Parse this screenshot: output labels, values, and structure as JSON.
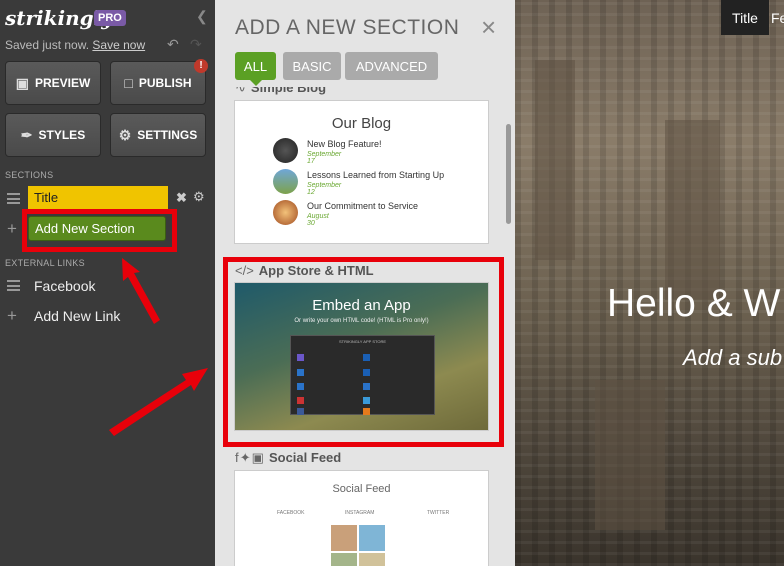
{
  "sidebar": {
    "logo": "strikingly",
    "pro_badge": "PRO",
    "status": "Saved just now.",
    "save_now": "Save now",
    "buttons": {
      "preview": "PREVIEW",
      "publish": "PUBLISH",
      "styles": "STYLES",
      "settings": "SETTINGS",
      "publish_alert": "!"
    },
    "sections_heading": "SECTIONS",
    "section_items": [
      {
        "label": "Title",
        "color": "#f0c400"
      }
    ],
    "add_section": "Add New Section",
    "external_links_heading": "EXTERNAL LINKS",
    "external_links": [
      "Facebook"
    ],
    "add_link": "Add New Link"
  },
  "panel": {
    "title": "ADD A NEW SECTION",
    "tabs": [
      "ALL",
      "BASIC",
      "ADVANCED"
    ],
    "active_tab": "ALL",
    "accent": "#5ba024",
    "cards": {
      "simple_blog": {
        "label": "Simple Blog",
        "blog_title": "Our Blog",
        "posts": [
          {
            "title": "New Blog Feature!",
            "date": "September 17"
          },
          {
            "title": "Lessons Learned from Starting Up",
            "date": "September 12"
          },
          {
            "title": "Our Commitment to Service",
            "date": "August 30"
          }
        ]
      },
      "app_store": {
        "label": "App Store & HTML",
        "symbol": "</>",
        "embed_title": "Embed an App",
        "embed_sub": "Or write your own HTML code! (HTML is Pro only!)",
        "modal_title": "STRIKINGLY APP STORE"
      },
      "social_feed": {
        "label": "Social Feed",
        "feed_title": "Social Feed",
        "columns": [
          "FACEBOOK",
          "INSTAGRAM",
          "TWITTER"
        ]
      }
    }
  },
  "preview": {
    "nav_active": "Title",
    "nav_next": "Fe",
    "hero_title": "Hello & W",
    "hero_subtitle": "Add a sub"
  },
  "annotation_color": "#e8000a"
}
